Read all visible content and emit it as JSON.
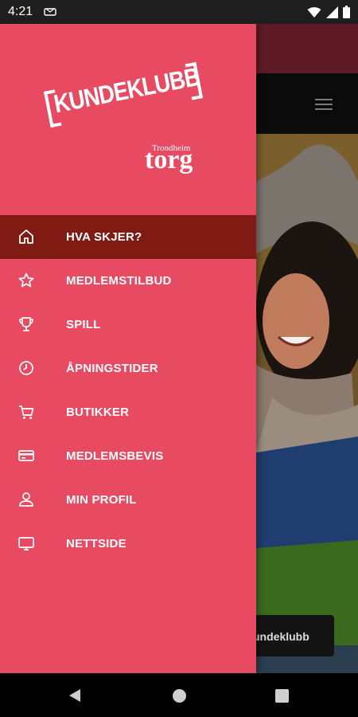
{
  "status_bar": {
    "time": "4:21",
    "icons": [
      "notification-icon",
      "wifi-icon",
      "cell-signal-icon",
      "battery-icon"
    ]
  },
  "drawer": {
    "background_color": "#e84a61",
    "active_color": "#801b14",
    "logo": {
      "main": "KUNDEKLUBB",
      "small": "Trondheim",
      "big": "torg"
    },
    "items": [
      {
        "label": "HVA SKJER?",
        "icon": "home-icon",
        "active": true
      },
      {
        "label": "MEDLEMSTILBUD",
        "icon": "star-icon",
        "active": false
      },
      {
        "label": "SPILL",
        "icon": "trophy-icon",
        "active": false
      },
      {
        "label": "ÅPNINGSTIDER",
        "icon": "clock-icon",
        "active": false
      },
      {
        "label": "BUTIKKER",
        "icon": "cart-icon",
        "active": false
      },
      {
        "label": "MEDLEMSBEVIS",
        "icon": "card-icon",
        "active": false
      },
      {
        "label": "MIN PROFIL",
        "icon": "person-icon",
        "active": false
      },
      {
        "label": "NETTSIDE",
        "icon": "monitor-icon",
        "active": false
      }
    ]
  },
  "background": {
    "header_color": "#5e1b27",
    "button_text": "undeklubb"
  },
  "navbar": {
    "icons": [
      "back-icon",
      "home-circle-icon",
      "recents-icon"
    ]
  }
}
